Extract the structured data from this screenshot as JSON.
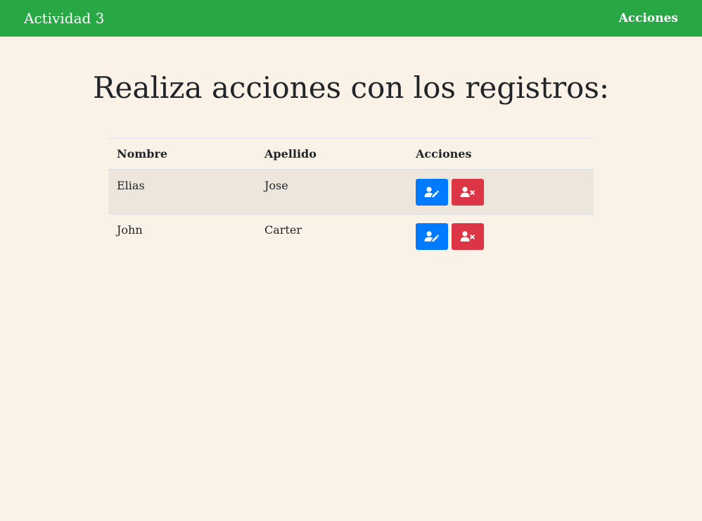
{
  "navbar": {
    "brand": "Actividad 3",
    "link": "Acciones"
  },
  "page": {
    "title": "Realiza acciones con los registros:"
  },
  "table": {
    "headers": [
      "Nombre",
      "Apellido",
      "Acciones"
    ],
    "rows": [
      {
        "nombre": "Elias",
        "apellido": "Jose"
      },
      {
        "nombre": "John",
        "apellido": "Carter"
      }
    ]
  },
  "icons": {
    "edit": "user-edit-icon",
    "delete": "user-times-icon"
  },
  "colors": {
    "navbar": "#28a745",
    "background": "#faf1e7",
    "edit_button": "#007bff",
    "delete_button": "#dc3545",
    "striped_row": "#ede6dd"
  }
}
